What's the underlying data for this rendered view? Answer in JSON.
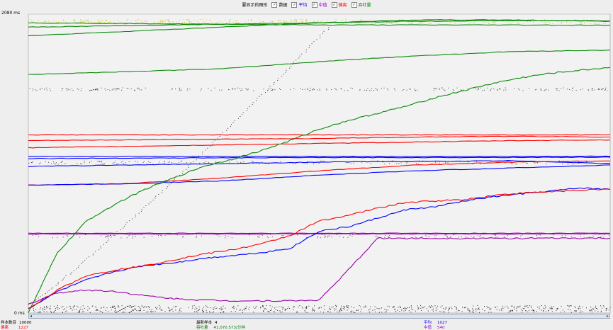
{
  "header": {
    "prompt": "要显示的图形",
    "options": [
      {
        "label": "数据",
        "checked": true,
        "color": "#000000"
      },
      {
        "label": "平均",
        "checked": true,
        "color": "#0000ff"
      },
      {
        "label": "中值",
        "checked": true,
        "color": "#9900cc"
      },
      {
        "label": "偏离",
        "checked": true,
        "color": "#ff0000"
      },
      {
        "label": "吞吐量",
        "checked": true,
        "color": "#008000"
      }
    ]
  },
  "chart_data": {
    "type": "line",
    "ylim": [
      0,
      2080
    ],
    "yticks": [
      "2080 ms",
      "0 ms"
    ],
    "x": [
      0,
      5,
      10,
      15,
      20,
      25,
      30,
      35,
      40,
      45,
      50,
      55,
      60,
      65,
      70,
      75,
      80,
      85,
      90,
      95,
      100
    ],
    "series": [
      {
        "key": "throughput",
        "color": "#0a8a0a",
        "values": [
          0,
          420,
          640,
          760,
          860,
          940,
          1020,
          1070,
          1130,
          1200,
          1280,
          1340,
          1390,
          1440,
          1500,
          1550,
          1600,
          1640,
          1670,
          1690,
          1710
        ]
      },
      {
        "key": "average",
        "color": "#0000ff",
        "values": [
          30,
          150,
          230,
          290,
          330,
          350,
          380,
          400,
          420,
          450,
          570,
          600,
          660,
          720,
          740,
          780,
          810,
          830,
          850,
          870,
          860
        ]
      },
      {
        "key": "deviation",
        "color": "#ff0000",
        "values": [
          30,
          160,
          260,
          300,
          330,
          370,
          410,
          440,
          480,
          540,
          640,
          680,
          730,
          770,
          780,
          790,
          820,
          835,
          845,
          855,
          860
        ]
      },
      {
        "key": "median",
        "color": "#9900aa",
        "values": [
          60,
          140,
          160,
          150,
          120,
          100,
          90,
          85,
          85,
          85,
          90,
          300,
          520,
          520,
          520,
          520,
          520,
          520,
          520,
          520,
          520
        ]
      }
    ],
    "reference_lines": [
      {
        "color": "#0a8a0a",
        "y": [
          2020,
          2015,
          2010,
          2005,
          2005,
          2005,
          2003
        ]
      },
      {
        "color": "#0a8a0a",
        "y": [
          1990,
          2000,
          2010,
          2020,
          2030,
          2035,
          2035
        ]
      },
      {
        "color": "#0a8a0a",
        "y": [
          1930,
          1960,
          1990,
          2020,
          2040,
          2040,
          2030
        ]
      },
      {
        "color": "#0a8a0a",
        "y": [
          1660,
          1680,
          1700,
          1750,
          1790,
          1820,
          1830
        ]
      },
      {
        "color": "#ff0000",
        "y": [
          1240,
          1240,
          1240,
          1240,
          1240,
          1240,
          1240
        ]
      },
      {
        "color": "#ff0000",
        "y": [
          1200,
          1205,
          1210,
          1215,
          1225,
          1230,
          1225
        ]
      },
      {
        "color": "#ff0000",
        "y": [
          1150,
          1160,
          1170,
          1180,
          1190,
          1200,
          1205
        ]
      },
      {
        "color": "#0000ff",
        "y": [
          1090,
          1090,
          1090,
          1090,
          1090,
          1090,
          1092
        ]
      },
      {
        "color": "#0000ff",
        "y": [
          1075,
          1078,
          1080,
          1082,
          1082,
          1083,
          1085
        ]
      },
      {
        "color": "#0000ff",
        "y": [
          1020,
          1030,
          1040,
          1050,
          1055,
          1060,
          1040
        ]
      },
      {
        "color": "#ff0000",
        "y": [
          890,
          900,
          940,
          990,
          1030,
          1050,
          1060
        ]
      },
      {
        "color": "#0000ff",
        "y": [
          890,
          900,
          920,
          960,
          990,
          1010,
          1030
        ]
      },
      {
        "color": "#9900aa",
        "y": [
          555,
          555,
          555,
          555,
          555,
          555,
          555
        ]
      },
      {
        "color": "#9900aa",
        "y": [
          550,
          550,
          550,
          550,
          550,
          550,
          552
        ]
      }
    ],
    "scatter_bands": [
      {
        "y": 2030,
        "spread": 15,
        "color": "#c8c800",
        "count": 420
      },
      {
        "y": 1560,
        "spread": 10,
        "color": "#444444",
        "count": 260
      },
      {
        "y": 1050,
        "spread": 12,
        "color": "#444444",
        "count": 200
      },
      {
        "y": 540,
        "spread": 15,
        "color": "#444444",
        "count": 180
      },
      {
        "y": 30,
        "spread": 25,
        "color": "#222222",
        "count": 700
      }
    ]
  },
  "footer": {
    "total_samples_label": "样本数目",
    "total_samples_value": "10000",
    "latest_sample_label": "最新样本",
    "latest_sample_value": "4",
    "average_label": "平均",
    "average_value": "1027",
    "deviation_label": "偏离",
    "deviation_value": "1227",
    "throughput_label": "吞吐量",
    "throughput_value": "41,070.573/分钟",
    "median_label": "中值",
    "median_value": "540"
  },
  "colors": {
    "plot_bg": "#f2f2f2",
    "grid": "#d8d8d8"
  }
}
